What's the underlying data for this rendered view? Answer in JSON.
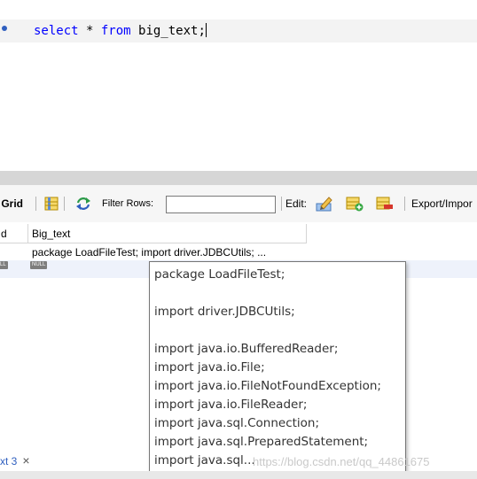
{
  "editor": {
    "sql": {
      "kw_select": "select",
      "star": " * ",
      "kw_from": "from",
      "table": " big_text;"
    }
  },
  "toolbar": {
    "result_grid_label": "t Grid",
    "filter_rows_label": "Filter Rows:",
    "filter_rows_value": "",
    "edit_label": "Edit:",
    "export_label": "Export/Impor"
  },
  "grid": {
    "columns": [
      "d",
      "Big_text"
    ],
    "rows": [
      {
        "cell": "package LoadFileTest;  import driver.JDBCUtils; ..."
      },
      {
        "cell": ""
      }
    ],
    "null_label": "NULL",
    "null_label_partial": "LL"
  },
  "popup": {
    "lines": [
      "package LoadFileTest;",
      "",
      "import driver.JDBCUtils;",
      "",
      "import java.io.BufferedReader;",
      "import java.io.File;",
      "import java.io.FileNotFoundException;",
      "import java.io.FileReader;",
      "import java.sql.Connection;",
      "import java.sql.PreparedStatement;",
      "import java.sql..."
    ]
  },
  "tabs": {
    "bottom_tab_label": "xt 3",
    "close_glyph": "×"
  },
  "watermark": "https://blog.csdn.net/qq_44861675",
  "colors": {
    "keyword": "#0000ff",
    "accent": "#2f5fbf",
    "splitter": "#d6d6d6"
  }
}
